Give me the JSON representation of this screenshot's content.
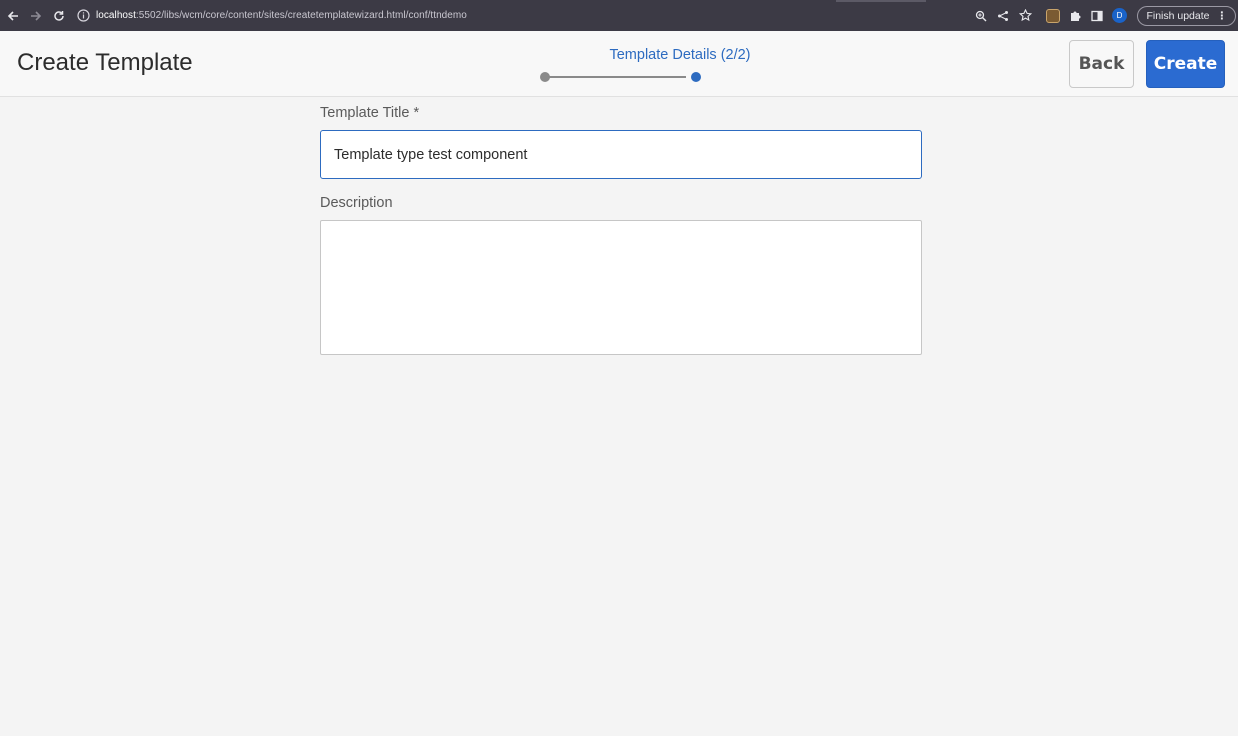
{
  "browser": {
    "url_host": "localhost",
    "url_rest": ":5502/libs/wcm/core/content/sites/createtemplatewizard.html/conf/ttndemo",
    "profile_initial": "D",
    "finish_update_label": "Finish update",
    "icons": [
      "back-arrow-icon",
      "forward-arrow-icon",
      "reload-icon",
      "info-icon",
      "zoom-icon",
      "share-icon",
      "star-icon",
      "extension-icon",
      "puzzle-icon",
      "side-panel-icon",
      "profile-icon",
      "more-menu-icon"
    ]
  },
  "header": {
    "title": "Create Template",
    "step_label": "Template Details (2/2)",
    "steps_total": 2,
    "current_step": 2,
    "back_label": "Back",
    "create_label": "Create",
    "accent_color": "#2b6bd1"
  },
  "form": {
    "title_label": "Template Title *",
    "title_value": "Template type test component",
    "description_label": "Description",
    "description_value": ""
  }
}
